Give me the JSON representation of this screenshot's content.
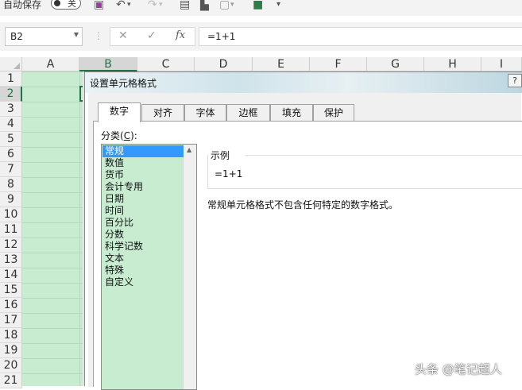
{
  "toolbar": {
    "autosave_label": "自动保存",
    "toggle_state": "关"
  },
  "formula_bar": {
    "name_box": "B2",
    "separator": "⋮",
    "cancel_symbol": "✕",
    "enter_symbol": "✓",
    "fx_symbol": "fx",
    "formula": "=1+1"
  },
  "grid": {
    "columns": [
      "A",
      "B",
      "C",
      "D",
      "E",
      "F",
      "G",
      "H",
      "I"
    ],
    "rows": [
      "1",
      "2",
      "3",
      "4",
      "5",
      "6",
      "7",
      "8",
      "9",
      "10",
      "11",
      "12",
      "13",
      "14",
      "15",
      "16",
      "17",
      "18",
      "19",
      "20",
      "21"
    ],
    "selected_column": "B",
    "selected_row": "2"
  },
  "dialog": {
    "title": "设置单元格格式",
    "help_label": "?",
    "tabs": [
      {
        "label": "数字",
        "active": true
      },
      {
        "label": "对齐",
        "active": false
      },
      {
        "label": "字体",
        "active": false
      },
      {
        "label": "边框",
        "active": false
      },
      {
        "label": "填充",
        "active": false
      },
      {
        "label": "保护",
        "active": false
      }
    ],
    "category_label_pre": "分类(",
    "category_label_key": "C",
    "category_label_post": "):",
    "categories": [
      "常规",
      "数值",
      "货币",
      "会计专用",
      "日期",
      "时间",
      "百分比",
      "分数",
      "科学记数",
      "文本",
      "特殊",
      "自定义"
    ],
    "selected_category": "常规",
    "sample_label": "示例",
    "sample_value": "=1+1",
    "description": "常规单元格格式不包含任何特定的数字格式。"
  },
  "watermark": "头条 @笔记超人",
  "colors": {
    "excel_green": "#217346",
    "cell_fill": "#c7ecd0",
    "selection_blue": "#3399ff"
  }
}
